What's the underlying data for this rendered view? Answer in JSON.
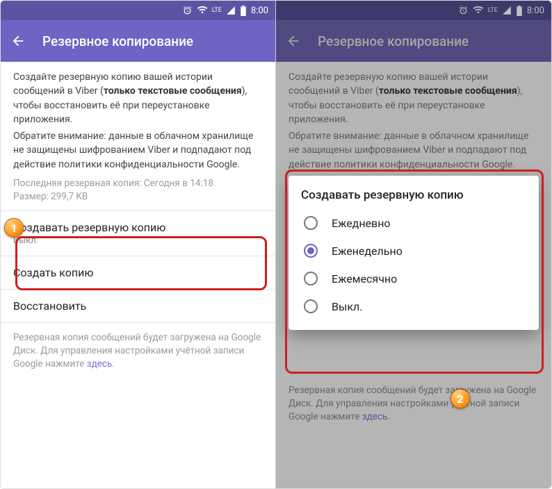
{
  "statusbar": {
    "time": "8:00",
    "lte": "LTE"
  },
  "appbar": {
    "title": "Резервное копирование"
  },
  "intro": {
    "line1a": "Создайте резервную копию вашей истории сообщений в Viber (",
    "line1b": "только текстовые сообщения",
    "line1c": "), чтобы восстановить её при переустановке приложения.",
    "line2": "Обратите внимание: данные в облачном хранилище не защищены шифрованием Viber и подпадают под действие политики конфиденциальности Google."
  },
  "last_backup_label": "Последняя резервная копия: Сегодня в 14:18",
  "size_label": "Размер: 299,7 KB",
  "items": {
    "schedule": {
      "title": "Создавать резервную копию",
      "value": "Выкл."
    },
    "backup_now": {
      "title": "Создать копию"
    },
    "restore": {
      "title": "Восстановить"
    }
  },
  "footer": {
    "text": "Резервная копия сообщений будет загружена на Google Диск. Для управления настройками учётной записи Google нажмите ",
    "link": "здесь",
    "dot": "."
  },
  "dialog": {
    "title": "Создавать резервную копию",
    "options": {
      "daily": "Ежедневно",
      "weekly": "Еженедельно",
      "monthly": "Ежемесячно",
      "off": "Выкл."
    },
    "selected": "weekly"
  },
  "badges": {
    "one": "1",
    "two": "2"
  }
}
